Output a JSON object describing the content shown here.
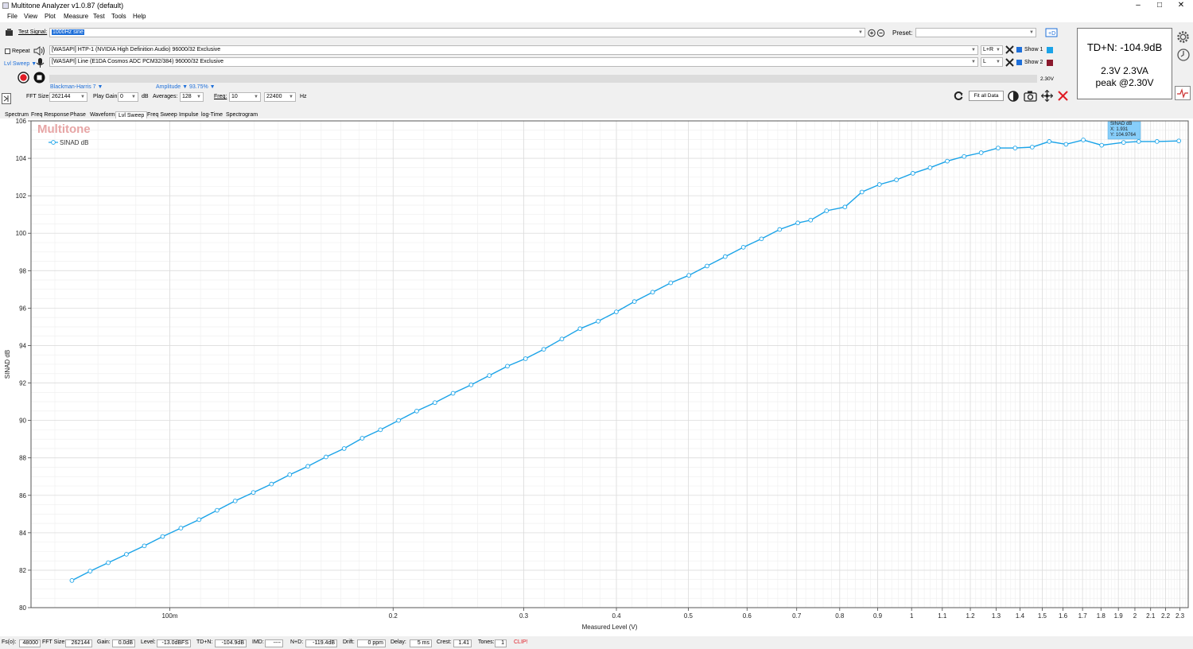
{
  "window": {
    "title": "Multitone Analyzer v1.0.87 (default)",
    "minimize": "–",
    "maximize": "□",
    "close": "✕"
  },
  "menu": [
    "File",
    "View",
    "Plot",
    "Measure",
    "Test",
    "Tools",
    "Help"
  ],
  "toolbar": {
    "test_signal_label": "Test Signal:",
    "test_signal_value": "1000Hz sine",
    "preset_label": "Preset:",
    "preset_value": "",
    "repeat_label": "Repeat",
    "output_device": "[WASAPI] HTP-1 (NVIDIA High Definition Audio) 96000/32 Exclusive",
    "input_device": "[WASAPI] Line (E1DA Cosmos ADC PCM32/384) 96000/32 Exclusive",
    "output_channel": "L+R",
    "input_channel": "L",
    "show1_label": "Show 1",
    "show2_label": "Show 2",
    "show1_color": "#1aa3e8",
    "show2_color": "#8b1a2e",
    "lvl_sweep_label": "Lvl Sweep ▼",
    "window_fn": "Blackman-Harris 7 ▼",
    "amplitude": "Amplitude ▼ 93.75% ▼",
    "level_display": "2.30V",
    "fft_size_label": "FFT Size:",
    "fft_size": "262144",
    "play_gain_label": "Play Gain:",
    "play_gain": "0",
    "db_unit": "dB",
    "averages_label": "Averages:",
    "averages": "128",
    "freq_label": "Freq:",
    "freq_min": "10",
    "freq_max": "22400",
    "hz_unit": "Hz",
    "fit_all_label": "Fit all Data"
  },
  "readout": {
    "line1": "TD+N: -104.9dB",
    "line2": "2.3V  2.3VA",
    "line3": "peak @2.30V"
  },
  "tabs": [
    "Spectrum",
    "Freq Response",
    "Phase",
    "Waveform",
    "Lvl Sweep",
    "Freq Sweep",
    "Impulse",
    "log-Time",
    "Spectrogram"
  ],
  "active_tab": "Lvl Sweep",
  "plot": {
    "watermark": "Multitone",
    "tooltip": {
      "line1": "SINAD dB",
      "line2": "X: 1.931",
      "line3": "Y: 104.9764"
    }
  },
  "chart_data": {
    "type": "line",
    "xlabel": "Measured Level (V)",
    "ylabel": "SINAD dB",
    "xscale": "log",
    "xlim": [
      0.065,
      2.36
    ],
    "ylim": [
      80,
      106
    ],
    "grid": true,
    "legend_placement": "top-left",
    "color": "#1aa3e8",
    "x_tick_labels": [
      "100m",
      "0.2",
      "0.3",
      "0.4",
      "0.5",
      "0.6",
      "0.7",
      "0.8",
      "0.9",
      "1",
      "1.1",
      "1.2",
      "1.3",
      "1.4",
      "1.5",
      "1.6",
      "1.7",
      "1.8",
      "1.9",
      "2",
      "2.1",
      "2.2",
      "2.3"
    ],
    "x_ticks": [
      0.1,
      0.2,
      0.3,
      0.4,
      0.5,
      0.6,
      0.7,
      0.8,
      0.9,
      1,
      1.1,
      1.2,
      1.3,
      1.4,
      1.5,
      1.6,
      1.7,
      1.8,
      1.9,
      2,
      2.1,
      2.2,
      2.3
    ],
    "y_ticks": [
      80,
      82,
      84,
      86,
      88,
      90,
      92,
      94,
      96,
      98,
      100,
      102,
      104,
      106
    ],
    "series": [
      {
        "name": "SINAD dB",
        "x": [
          0.0738,
          0.0781,
          0.0826,
          0.0874,
          0.0924,
          0.0978,
          0.1035,
          0.1095,
          0.1158,
          0.1225,
          0.1296,
          0.1371,
          0.1451,
          0.1535,
          0.1624,
          0.1718,
          0.1817,
          0.1923,
          0.2034,
          0.2152,
          0.2277,
          0.2409,
          0.2548,
          0.2696,
          0.2852,
          0.3017,
          0.3192,
          0.3377,
          0.3573,
          0.378,
          0.3999,
          0.423,
          0.4476,
          0.4735,
          0.5009,
          0.53,
          0.5607,
          0.5932,
          0.6275,
          0.6639,
          0.7024,
          0.731,
          0.768,
          0.813,
          0.857,
          0.905,
          0.954,
          1.004,
          1.059,
          1.117,
          1.177,
          1.241,
          1.308,
          1.379,
          1.454,
          1.533,
          1.615,
          1.704,
          1.804,
          1.931,
          2.024,
          2.142,
          2.292
        ],
        "y": [
          81.45,
          81.95,
          82.4,
          82.85,
          83.3,
          83.8,
          84.25,
          84.7,
          85.2,
          85.7,
          86.15,
          86.6,
          87.1,
          87.55,
          88.05,
          88.5,
          89.05,
          89.5,
          90.0,
          90.5,
          90.95,
          91.45,
          91.9,
          92.4,
          92.9,
          93.3,
          93.8,
          94.35,
          94.9,
          95.3,
          95.8,
          96.35,
          96.85,
          97.35,
          97.75,
          98.25,
          98.75,
          99.25,
          99.7,
          100.2,
          100.55,
          100.7,
          101.2,
          101.4,
          102.2,
          102.6,
          102.85,
          103.2,
          103.5,
          103.85,
          104.1,
          104.3,
          104.55,
          104.55,
          104.6,
          104.9,
          104.75,
          104.98,
          104.7,
          104.85,
          104.9,
          104.9,
          104.93
        ]
      }
    ]
  },
  "status": {
    "fs_label": "Fs(o):",
    "fs": "48000",
    "fft_label": "FFT Size:",
    "fft": "262144",
    "gain_label": "Gain:",
    "gain": "0.0dB",
    "level_label": "Level:",
    "level": "-13.0dBFS",
    "tdn_label": "TD+N:",
    "tdn": "-104.9dB",
    "imd_label": "IMD:",
    "imd": "----",
    "nd_label": "N+D:",
    "nd": "-119.4dB",
    "drift_label": "Drift:",
    "drift": "0  ppm",
    "delay_label": "Delay:",
    "delay": "5  ms",
    "crest_label": "Crest:",
    "crest": "1.41",
    "tones_label": "Tones:",
    "tones": "1",
    "clip": "CLIP!"
  }
}
